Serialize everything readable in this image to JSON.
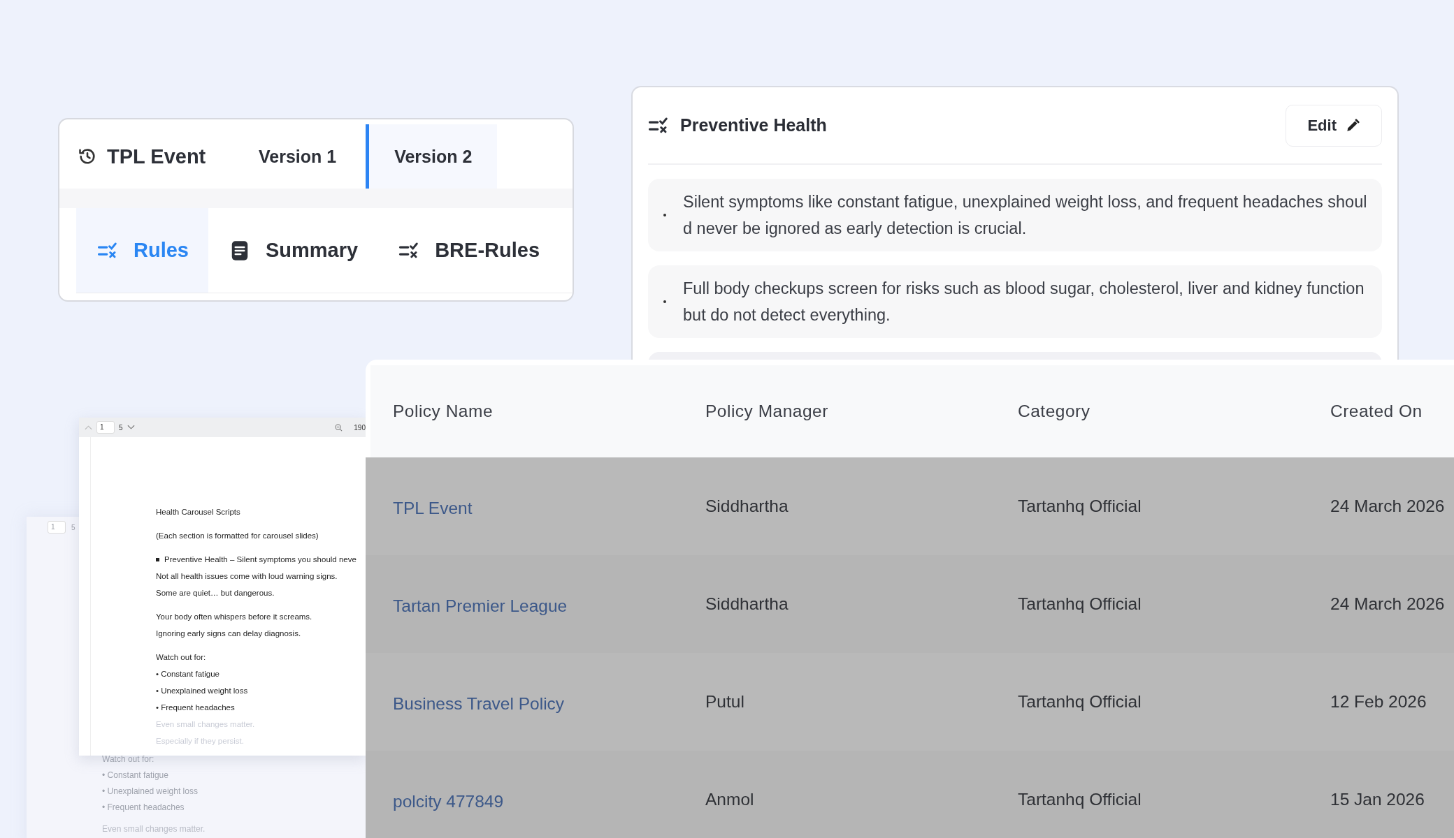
{
  "tabs_card": {
    "title": "TPL Event",
    "versions": [
      {
        "label": "Version 1",
        "selected": false
      },
      {
        "label": "Version 2",
        "selected": true
      }
    ],
    "sections": [
      {
        "label": "Rules",
        "kind": "rules",
        "selected": true
      },
      {
        "label": "Summary",
        "kind": "summary",
        "selected": false
      },
      {
        "label": "BRE-Rules",
        "kind": "rules",
        "selected": false
      }
    ]
  },
  "rule_card": {
    "title": "Preventive Health",
    "edit_button": "Edit",
    "items": [
      "Silent symptoms like constant fatigue, unexplained weight loss, and frequent headaches should never be ignored as early detection is crucial.",
      "Full body checkups screen for risks such as blood sugar, cholesterol, liver and kidney function but do not detect everything."
    ]
  },
  "document_back": {
    "page": "1",
    "page_count": "5",
    "lines": [
      {
        "text": "Watch out for:",
        "kind": "para"
      },
      {
        "text": "• Constant fatigue",
        "kind": "item"
      },
      {
        "text": "• Unexplained weight loss",
        "kind": "item"
      },
      {
        "text": "• Frequent headaches",
        "kind": "item"
      },
      {
        "text": "Even small changes matter.",
        "kind": "gap"
      }
    ]
  },
  "document_front": {
    "page": "1",
    "page_count": "5",
    "zoom": "190",
    "lines": [
      {
        "text": "Health Carousel Scripts",
        "kind": "gap"
      },
      {
        "text": "(Each section is formatted for carousel slides)",
        "kind": "gap"
      },
      {
        "text": "Preventive Health – Silent symptoms you should neve",
        "kind": "bullet"
      },
      {
        "text": "Not all health issues come with loud warning signs.",
        "kind": "para"
      },
      {
        "text": "Some are quiet… but dangerous.",
        "kind": "para"
      },
      {
        "text": "Your body often whispers before it screams.",
        "kind": "gap"
      },
      {
        "text": "Ignoring early signs can delay diagnosis.",
        "kind": "para"
      },
      {
        "text": "Watch out for:",
        "kind": "gap"
      },
      {
        "text": "• Constant fatigue",
        "kind": "para"
      },
      {
        "text": "• Unexplained weight loss",
        "kind": "para"
      },
      {
        "text": "• Frequent headaches",
        "kind": "para"
      },
      {
        "text": "Even small changes matter.",
        "kind": "faded"
      },
      {
        "text": "Especially if they persist.",
        "kind": "faded"
      }
    ]
  },
  "table": {
    "columns": [
      "Policy Name",
      "Policy Manager",
      "Category",
      "Created On"
    ],
    "rows": [
      {
        "policy_name": "TPL Event",
        "policy_manager": "Siddhartha",
        "category": "Tartanhq Official",
        "created_on": "24 March 2026"
      },
      {
        "policy_name": "Tartan Premier League",
        "policy_manager": "Siddhartha",
        "category": "Tartanhq Official",
        "created_on": "24 March 2026"
      },
      {
        "policy_name": "Business Travel Policy",
        "policy_manager": "Putul",
        "category": "Tartanhq Official",
        "created_on": "12 Feb 2026"
      },
      {
        "policy_name": "polcity 477849",
        "policy_manager": "Anmol",
        "category": "Tartanhq Official",
        "created_on": "15 Jan 2026"
      }
    ]
  }
}
